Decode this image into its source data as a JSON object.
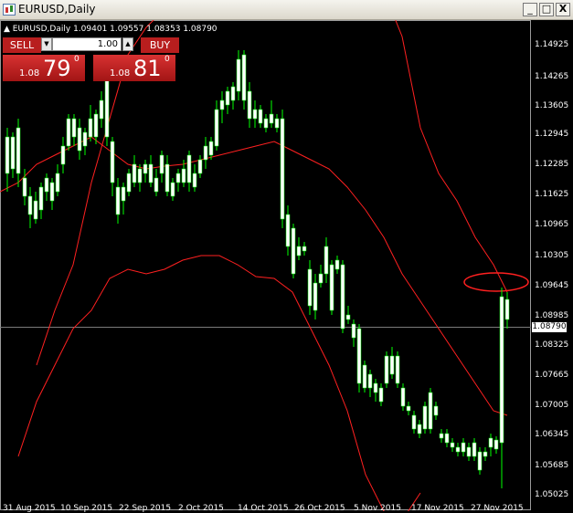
{
  "window": {
    "title": "EURUSD,Daily",
    "buttons": [
      "_",
      "□",
      "X"
    ],
    "icon": "chart-window-icon"
  },
  "chart": {
    "symbol_label": "EURUSD,Daily",
    "ohlc": "1.09401 1.09557 1.08353 1.08790",
    "current_price": "1.08790",
    "colors": {
      "background": "#000000",
      "candle": "#ffffff",
      "wick": "#00ff00",
      "bands": "#ff2020",
      "grid": "#ffffff"
    }
  },
  "trade_panel": {
    "sell_label": "SELL",
    "buy_label": "BUY",
    "lot": "1.00",
    "sell": {
      "small": "1.08",
      "big": "79",
      "sup": "0"
    },
    "buy": {
      "small": "1.08",
      "big": "81",
      "sup": "0"
    }
  },
  "price_axis": [
    "1.14925",
    "1.14265",
    "1.13605",
    "1.12945",
    "1.12285",
    "1.11625",
    "1.10965",
    "1.10305",
    "1.09645",
    "1.08985",
    "1.08325",
    "1.07665",
    "1.07005",
    "1.06345",
    "1.05685",
    "1.05025"
  ],
  "time_axis": [
    "31 Aug 2015",
    "10 Sep 2015",
    "22 Sep 2015",
    "2 Oct 2015",
    "14 Oct 2015",
    "26 Oct 2015",
    "5 Nov 2015",
    "17 Nov 2015",
    "27 Nov 2015"
  ]
}
